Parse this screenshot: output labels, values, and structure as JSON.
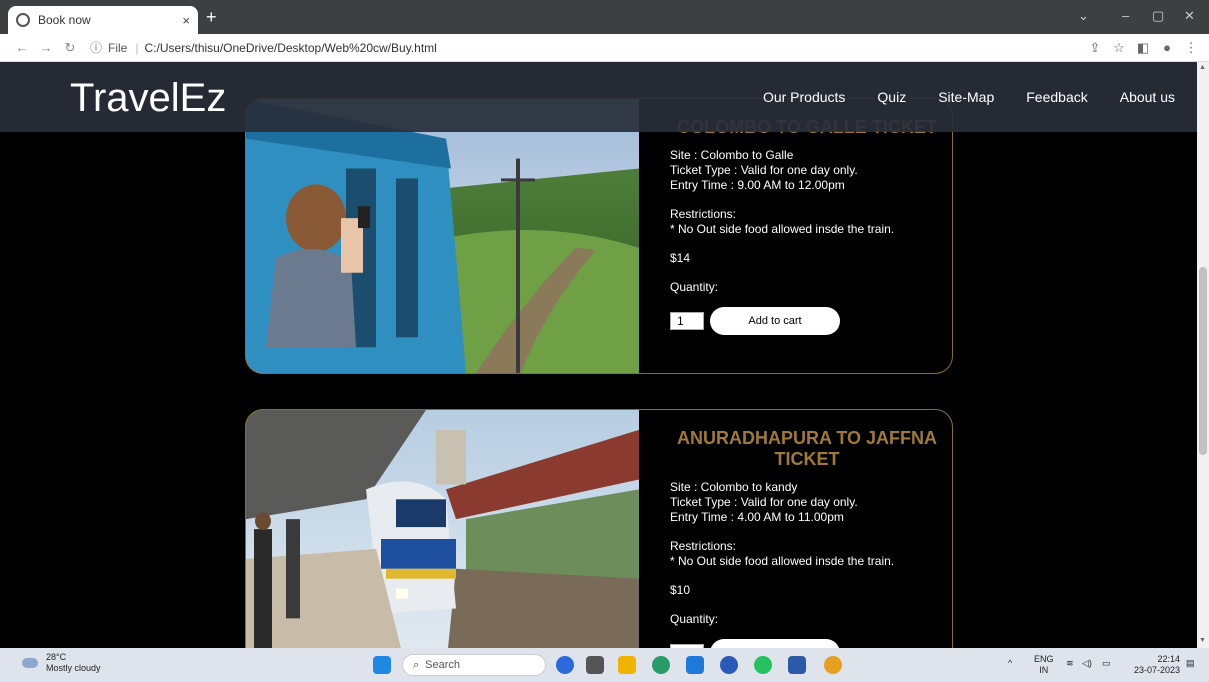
{
  "browser": {
    "tab_title": "Book now",
    "tab_close": "×",
    "new_tab": "+",
    "address": {
      "info": "ⓘ",
      "file_label": "File",
      "separator": "|",
      "url": "C:/Users/thisu/OneDrive/Desktop/Web%20cw/Buy.html"
    }
  },
  "site": {
    "logo": "TravelEz",
    "nav": [
      "Our Products",
      "Quiz",
      "Site-Map",
      "Feedback",
      "About us"
    ]
  },
  "cards": [
    {
      "title": "COLOMBO TO GALLE TICKET",
      "site": "Site : Colombo to Galle",
      "ticket_type": "Ticket Type : Valid for one day only.",
      "entry_time": "Entry Time : 9.00 AM to 12.00pm",
      "restrictions_label": "Restrictions:",
      "restriction": "* No Out side food allowed insde the train.",
      "price": "$14",
      "quantity_label": "Quantity:",
      "quantity_value": "1",
      "add_button": "Add to cart"
    },
    {
      "title": "ANURADHAPURA TO JAFFNA TICKET",
      "site": "Site : Colombo to kandy",
      "ticket_type": "Ticket Type : Valid for one day only.",
      "entry_time": "Entry Time : 4.00 AM to 11.00pm",
      "restrictions_label": "Restrictions:",
      "restriction": "* No Out side food allowed insde the train.",
      "price": "$10",
      "quantity_label": "Quantity:"
    }
  ],
  "taskbar": {
    "temperature": "28°C",
    "weather": "Mostly cloudy",
    "search_placeholder": "Search",
    "lang_top": "ENG",
    "lang_bottom": "IN",
    "time": "22:14",
    "date": "23-07-2023"
  }
}
